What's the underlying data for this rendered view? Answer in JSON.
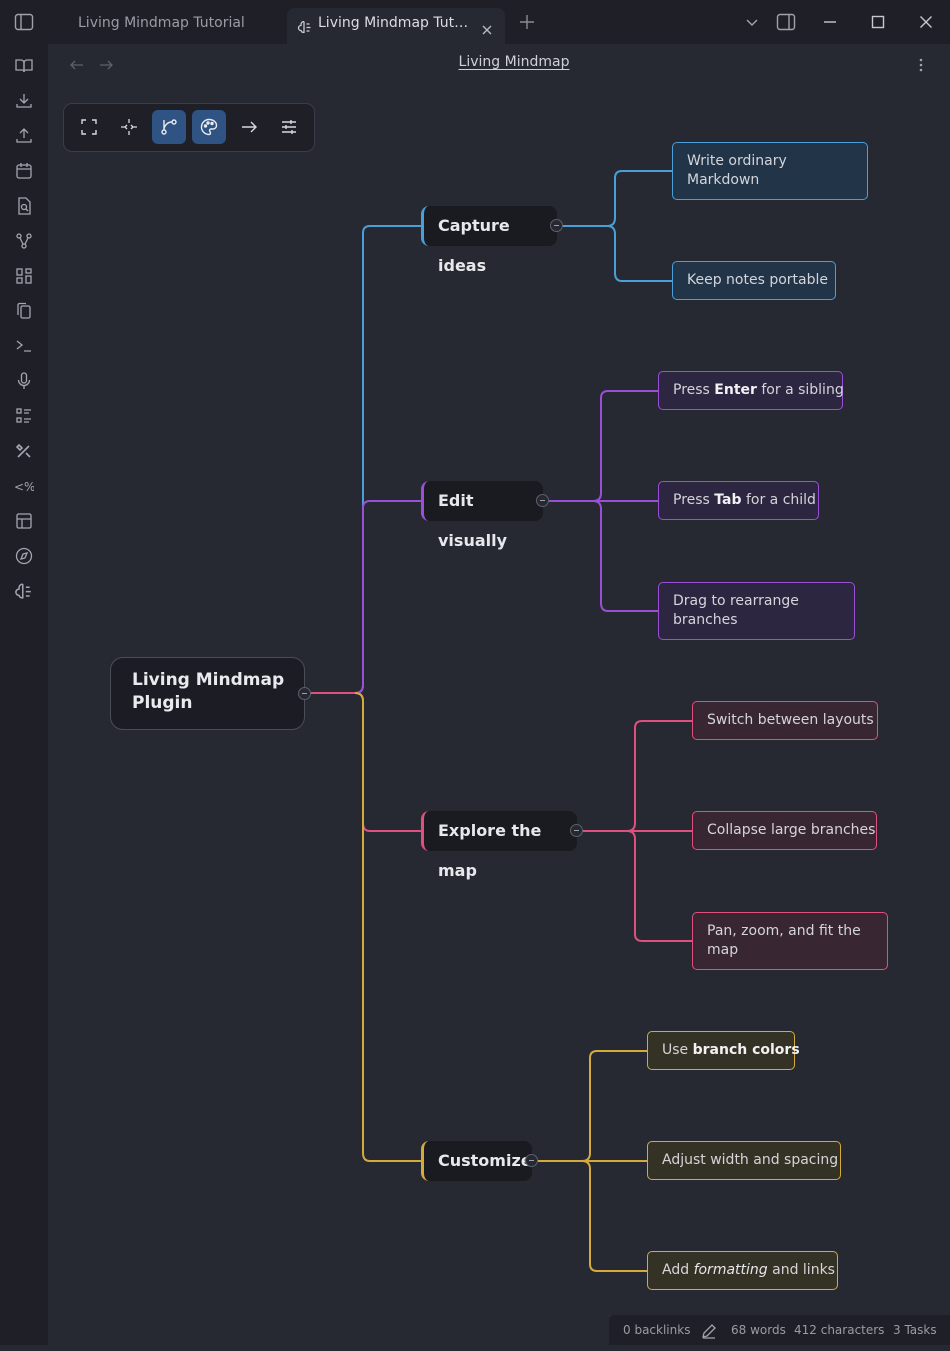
{
  "tabs": [
    {
      "label": "Living Mindmap Tutorial",
      "active": false
    },
    {
      "label": "Living Mindmap Tutorial",
      "active": true,
      "icon": "mindmap-icon"
    }
  ],
  "view": {
    "title": "Living Mindmap"
  },
  "toolbar": {
    "buttons": [
      {
        "icon": "fullscreen-icon",
        "active": false
      },
      {
        "icon": "fit-center-icon",
        "active": false
      },
      {
        "icon": "branch-layout-icon",
        "active": true
      },
      {
        "icon": "palette-icon",
        "active": true
      },
      {
        "icon": "arrow-right-icon",
        "active": false
      },
      {
        "icon": "sliders-icon",
        "active": false
      }
    ]
  },
  "ribbon": {
    "icons": [
      "book-open-icon",
      "download-icon",
      "upload-icon",
      "calendar-icon",
      "file-search-icon",
      "graph-icon",
      "grid-icon",
      "copy-icon",
      "terminal-icon",
      "microphone-icon",
      "list-icon",
      "tools-icon",
      "templater-icon",
      "layout-icon",
      "compass-icon",
      "mindmap-icon"
    ]
  },
  "mindmap": {
    "root": {
      "label": "Living Mindmap Plugin"
    },
    "branches": [
      {
        "label": "Capture ideas",
        "color": "#4a9fd8",
        "children": [
          {
            "text": "Write ordinary Markdown"
          },
          {
            "text": "Keep notes portable"
          }
        ]
      },
      {
        "label": "Edit visually",
        "color": "#9a50d6",
        "children": [
          {
            "pre": "Press ",
            "bold": "Enter",
            "post": " for a sibling"
          },
          {
            "pre": "Press ",
            "bold": "Tab",
            "post": " for a child"
          },
          {
            "text": "Drag to rearrange branches"
          }
        ]
      },
      {
        "label": "Explore the map",
        "color": "#e0507f",
        "children": [
          {
            "text": "Switch between layouts"
          },
          {
            "text": "Collapse large branches"
          },
          {
            "text": "Pan, zoom, and fit the map"
          }
        ]
      },
      {
        "label": "Customize",
        "color": "#d4aa3c",
        "children": [
          {
            "pre": "Use ",
            "bold": "branch colors",
            "post": ""
          },
          {
            "text": "Adjust width and spacing"
          },
          {
            "pre": "Add ",
            "italic": "formatting",
            "post": " and links"
          }
        ]
      }
    ]
  },
  "status": {
    "backlinks": "0 backlinks",
    "words": "68 words",
    "characters": "412 characters",
    "tasks": "3 Tasks"
  }
}
